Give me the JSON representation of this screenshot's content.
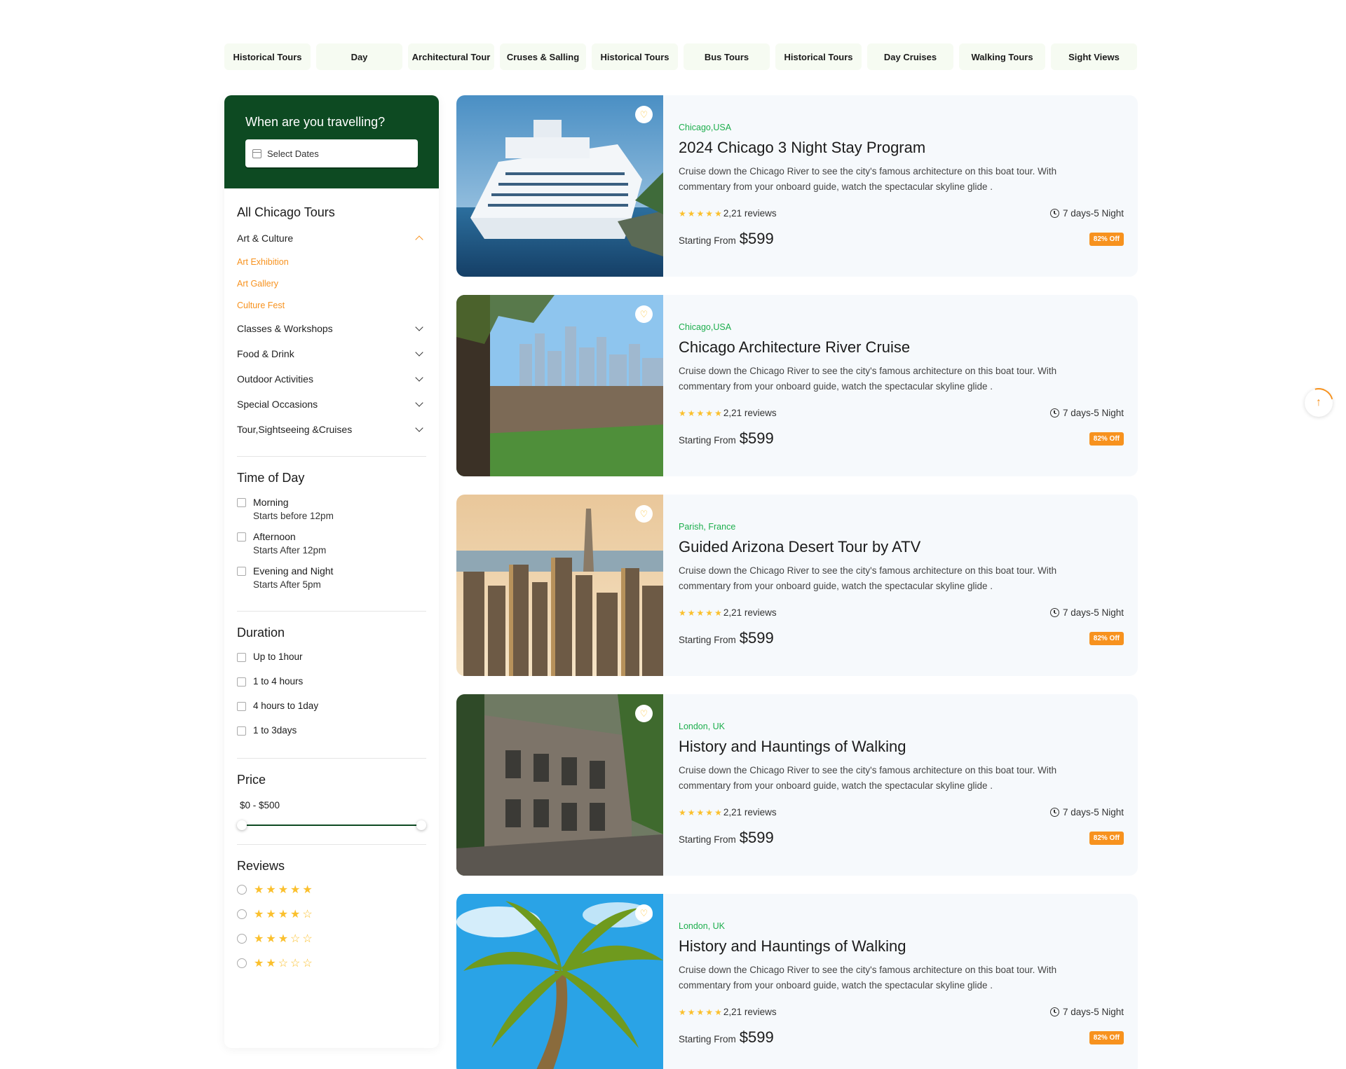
{
  "tabs": [
    "Historical Tours",
    "Day",
    "Architectural Tour",
    "Cruses & Salling",
    "Historical Tours",
    "Bus Tours",
    "Historical Tours",
    "Day Cruises",
    "Walking Tours",
    "Sight Views"
  ],
  "sidebar": {
    "when_title": "When are you travelling?",
    "date_placeholder": "Select Dates",
    "all_tours_title": "All Chicago Tours",
    "categories": [
      {
        "label": "Art & Culture",
        "expanded": true,
        "children": [
          "Art Exhibition",
          "Art Gallery",
          "Culture Fest"
        ]
      },
      {
        "label": "Classes & Workshops"
      },
      {
        "label": "Food & Drink"
      },
      {
        "label": "Outdoor Activities"
      },
      {
        "label": "Special Occasions"
      },
      {
        "label": "Tour,Sightseeing &Cruises"
      }
    ],
    "time_of_day": {
      "title": "Time of Day",
      "options": [
        {
          "label": "Morning",
          "sub": "Starts before 12pm"
        },
        {
          "label": "Afternoon",
          "sub": "Starts After 12pm"
        },
        {
          "label": "Evening and Night",
          "sub": "Starts After 5pm"
        }
      ]
    },
    "duration": {
      "title": "Duration",
      "options": [
        "Up to 1hour",
        "1 to 4 hours",
        "4 hours to 1day",
        "1 to 3days"
      ]
    },
    "price": {
      "title": "Price",
      "range_text": "$0 - $500",
      "min": 0,
      "max": 500
    },
    "reviews": {
      "title": "Reviews",
      "star_options": [
        5,
        4,
        3,
        2
      ]
    }
  },
  "tours": [
    {
      "location": "Chicago,USA",
      "title": "2024 Chicago 3 Night Stay Program",
      "description": "Cruise down the Chicago River to see the city's famous architecture on this boat tour. With commentary from your onboard guide, watch the spectacular skyline glide .",
      "reviews": "2,21 reviews",
      "duration": "7 days-5 Night",
      "price_label": "Starting From",
      "price": "$599",
      "discount": "82% Off",
      "image": "cruise-ship"
    },
    {
      "location": "Chicago,USA",
      "title": "Chicago Architecture River Cruise",
      "description": "Cruise down the Chicago River to see the city's famous architecture on this boat tour. With commentary from your onboard guide, watch the spectacular skyline glide .",
      "reviews": "2,21 reviews",
      "duration": "7 days-5 Night",
      "price_label": "Starting From",
      "price": "$599",
      "discount": "82% Off",
      "image": "city-skyline-river"
    },
    {
      "location": "Parish, France",
      "title": "Guided Arizona Desert Tour by ATV",
      "description": "Cruise down the Chicago River to see the city's famous architecture on this boat tour. With commentary from your onboard guide, watch the spectacular skyline glide .",
      "reviews": "2,21 reviews",
      "duration": "7 days-5 Night",
      "price_label": "Starting From",
      "price": "$599",
      "discount": "82% Off",
      "image": "aerial-city"
    },
    {
      "location": "London, UK",
      "title": "History and Hauntings of Walking",
      "description": "Cruise down the Chicago River to see the city's famous architecture on this boat tour. With commentary from your onboard guide, watch the spectacular skyline glide .",
      "reviews": "2,21 reviews",
      "duration": "7 days-5 Night",
      "price_label": "Starting From",
      "price": "$599",
      "discount": "82% Off",
      "image": "old-building"
    },
    {
      "location": "London, UK",
      "title": "History and Hauntings of Walking",
      "description": "Cruise down the Chicago River to see the city's famous architecture on this boat tour. With commentary from your onboard guide, watch the spectacular skyline glide .",
      "reviews": "2,21 reviews",
      "duration": "7 days-5 Night",
      "price_label": "Starting From",
      "price": "$599",
      "discount": "82% Off",
      "image": "palm-tree"
    }
  ],
  "colors": {
    "brand_green": "#0d4a22",
    "accent_orange": "#f7921e",
    "location_green": "#1dae4d",
    "star_yellow": "#fbc02d",
    "card_bg": "#f6f9fc"
  },
  "icons": {
    "favorite": "heart-icon",
    "duration": "clock-icon",
    "scroll_top": "arrow-up-icon",
    "calendar": "calendar-icon"
  }
}
